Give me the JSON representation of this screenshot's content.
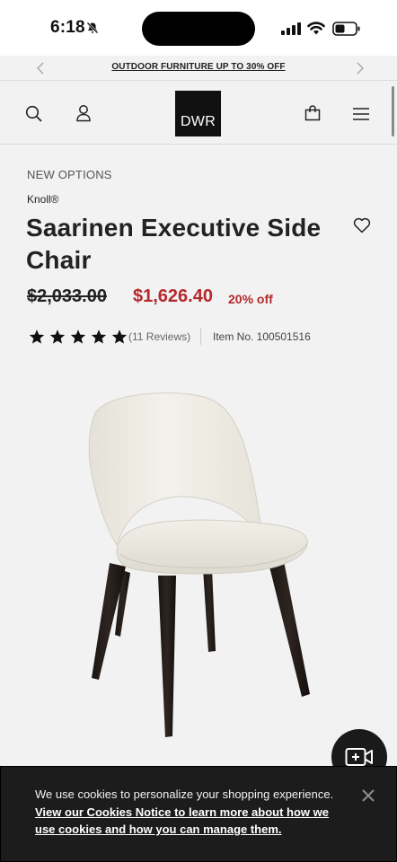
{
  "status": {
    "time": "6:18"
  },
  "promo": {
    "text": "OUTDOOR FURNITURE UP TO 30% OFF"
  },
  "header": {
    "logo_text": "DWR"
  },
  "product": {
    "eyebrow": "NEW OPTIONS",
    "brand": "Knoll®",
    "title": "Saarinen Executive Side Chair",
    "price_original": "$2,033.00",
    "price_sale": "$1,626.40",
    "discount": "20% off",
    "rating_stars": 5,
    "rating_stars_max": 5,
    "reviews": "(11 Reviews)",
    "item_number": "Item No. 100501516"
  },
  "cookie": {
    "text": "We use cookies to personalize your shopping experience.",
    "link": "View our Cookies Notice to learn more about how we use cookies and how you can manage them."
  },
  "colors": {
    "sale_red": "#b3282d",
    "background": "#f2f2f2",
    "banner_dark": "#1c1c1c"
  },
  "icons": [
    "bell-slash-icon",
    "signal-icon",
    "wifi-icon",
    "battery-icon",
    "chevron-left-icon",
    "chevron-right-icon",
    "search-icon",
    "account-icon",
    "cart-icon",
    "menu-icon",
    "heart-icon",
    "star-icon",
    "video-call-icon",
    "close-icon"
  ]
}
